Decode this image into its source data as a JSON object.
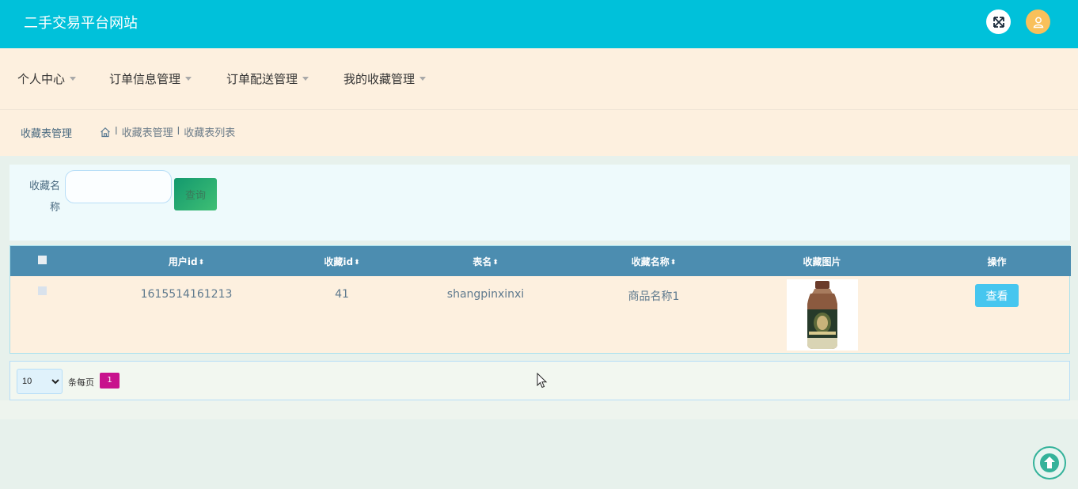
{
  "header": {
    "site_title": "二手交易平台网站",
    "icons": [
      "fullscreen-icon",
      "user-icon"
    ],
    "colors": {
      "topbar": "#00c1da",
      "user_avatar": "#f9c05a"
    }
  },
  "nav": {
    "items": [
      {
        "label": "个人中心"
      },
      {
        "label": "订单信息管理"
      },
      {
        "label": "订单配送管理"
      },
      {
        "label": "我的收藏管理"
      }
    ]
  },
  "breadcrumb": {
    "title": "收藏表管理",
    "home_icon": "home-icon",
    "separator": "l",
    "trail": [
      "收藏表管理",
      "收藏表列表"
    ]
  },
  "search": {
    "label_line1": "收藏名",
    "label_line2": "称",
    "input_value": "",
    "button_label": "查询"
  },
  "table": {
    "sort_icon": "⬍",
    "columns": [
      {
        "label": "",
        "type": "checkbox"
      },
      {
        "label": "用户id",
        "sortable": true
      },
      {
        "label": "收藏id",
        "sortable": true
      },
      {
        "label": "表名",
        "sortable": true
      },
      {
        "label": "收藏名称",
        "sortable": true
      },
      {
        "label": "收藏图片",
        "sortable": false
      },
      {
        "label": "操作",
        "sortable": false
      }
    ],
    "rows": [
      {
        "user_id": "1615514161213",
        "fav_id": "41",
        "table_name": "shangpinxinxi",
        "fav_name": "商品名称1",
        "image": "milk-tea-bottle-image",
        "action_label": "查看"
      }
    ],
    "colors": {
      "header": "#4c8db0",
      "row_bg": "#fdf0df"
    }
  },
  "pagination": {
    "page_size_options": [
      "10"
    ],
    "page_size_selected": "10",
    "per_page_label": "条每页",
    "current_page": "1",
    "active_color": "#c8128d"
  },
  "floating": {
    "back_to_top_icon": "arrow-up-icon"
  }
}
